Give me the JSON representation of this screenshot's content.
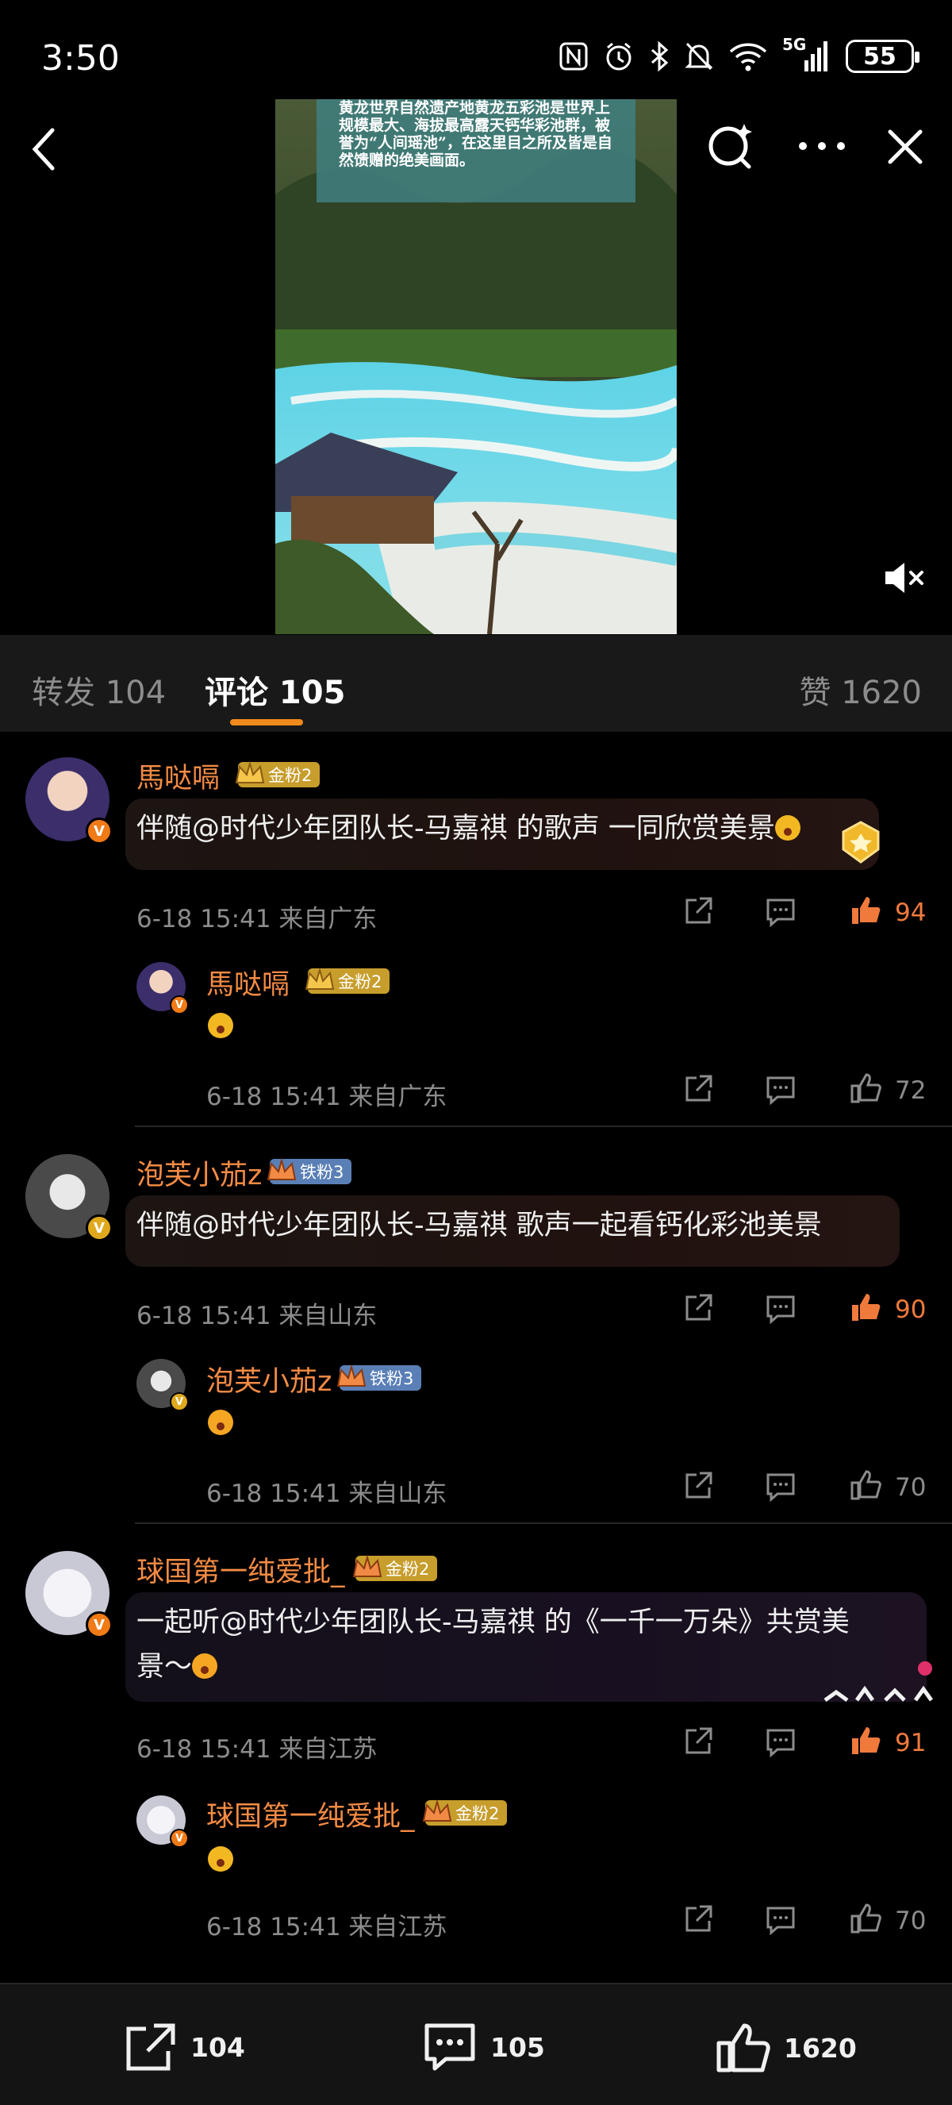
{
  "status_bar": {
    "time": "3:50",
    "network": "5G",
    "battery": "55",
    "icons": [
      "nfc-icon",
      "alarm-icon",
      "bluetooth-icon",
      "mute-bell-icon",
      "wifi-icon",
      "signal-icon",
      "battery-icon"
    ]
  },
  "video": {
    "overlay_text": "黄龙世界自然遗产地黄龙五彩池是世界上规模最大、海拔最高露天钙华彩池群，被誉为“人间瑶池”，在这里目之所及皆是自然馈赠的绝美画面。"
  },
  "tabs": {
    "repost": "转发 104",
    "comments": "评论 105",
    "likes": "赞 1620"
  },
  "comments": [
    {
      "user": "馬哒嗝",
      "badge": "金粉2",
      "text": "伴随@时代少年团队长-马嘉祺 的歌声 一同欣赏美景",
      "time": "6-18 15:41",
      "location": "来自广东",
      "likes": "94",
      "reply": {
        "user": "馬哒嗝",
        "badge": "金粉2",
        "time": "6-18 15:41",
        "location": "来自广东",
        "likes": "72"
      }
    },
    {
      "user": "泡芙小茄z",
      "badge": "铁粉3",
      "text": "伴随@时代少年团队长-马嘉祺 歌声一起看钙化彩池美景",
      "time": "6-18 15:41",
      "location": "来自山东",
      "likes": "90",
      "reply": {
        "user": "泡芙小茄z",
        "badge": "铁粉3",
        "time": "6-18 15:41",
        "location": "来自山东",
        "likes": "70"
      }
    },
    {
      "user": "球国第一纯爱批_",
      "badge": "金粉2",
      "text_line1": "一起听@时代少年团队长-马嘉祺 的《一千一万朵》共赏美",
      "text_line2": "景～",
      "time": "6-18 15:41",
      "location": "来自江苏",
      "likes": "91",
      "reply": {
        "user": "球国第一纯爱批_",
        "badge": "金粉2",
        "time": "6-18 15:41",
        "location": "来自江苏",
        "likes": "70"
      }
    }
  ],
  "bottom_bar": {
    "repost_count": "104",
    "comment_count": "105",
    "like_count": "1620"
  },
  "colors": {
    "accent": "#f08a1c",
    "username": "#f48b44",
    "gold_badge": "#c79d2c",
    "iron_badge": "#5a7fb6"
  }
}
